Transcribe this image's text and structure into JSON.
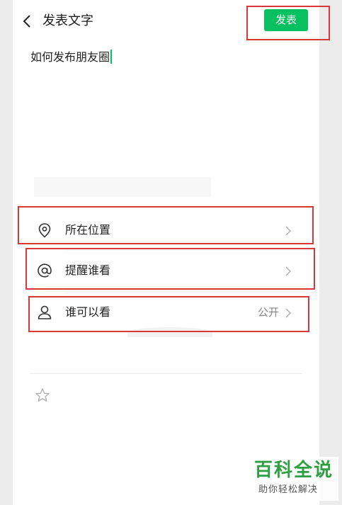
{
  "header": {
    "title": "发表文字",
    "publish_label": "发表"
  },
  "post": {
    "text": "如何发布朋友圈"
  },
  "options": [
    {
      "label": "所在位置",
      "value": "",
      "icon": "location-pin-icon"
    },
    {
      "label": "提醒谁看",
      "value": "",
      "icon": "at-sign-icon"
    },
    {
      "label": "谁可以看",
      "value": "公开",
      "icon": "person-icon"
    }
  ],
  "watermark": {
    "main": "百科全说",
    "sub": "助你轻松解决"
  },
  "colors": {
    "accent": "#07c160",
    "highlight": "#d9383a",
    "watermark": "#2ea043"
  }
}
